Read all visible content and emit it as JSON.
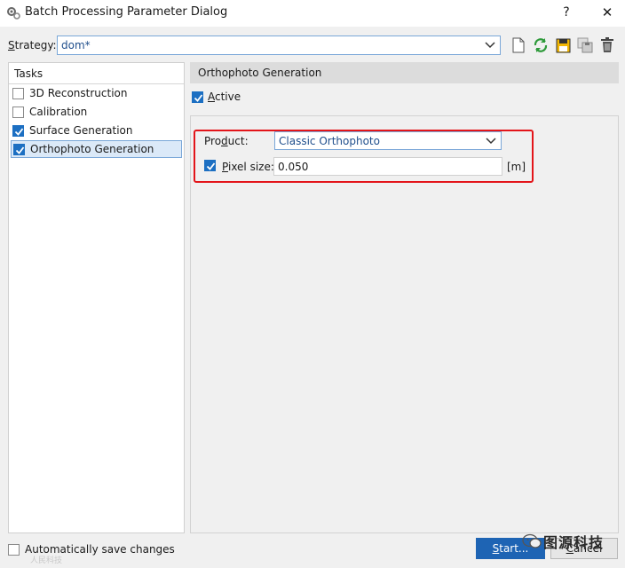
{
  "window": {
    "title": "Batch Processing Parameter Dialog",
    "help_label": "?",
    "close_label": "✕"
  },
  "strategy": {
    "label": "Strategy:",
    "value": "dom*"
  },
  "toolbar": {
    "icons": [
      "new-document-icon",
      "refresh-icon",
      "save-icon",
      "save-as-icon",
      "delete-icon"
    ]
  },
  "tasks": {
    "header": "Tasks",
    "items": [
      {
        "label": "3D Reconstruction",
        "checked": false,
        "selected": false
      },
      {
        "label": "Calibration",
        "checked": false,
        "selected": false
      },
      {
        "label": "Surface Generation",
        "checked": true,
        "selected": false
      },
      {
        "label": "Orthophoto Generation",
        "checked": true,
        "selected": true
      }
    ]
  },
  "section": {
    "title": "Orthophoto Generation",
    "active_label": "Active",
    "active_checked": true
  },
  "parameters": {
    "product_label": "Product:",
    "product_value": "Classic Orthophoto",
    "pixel_size_label": "Pixel size:",
    "pixel_size_checked": true,
    "pixel_size_value": "0.050",
    "pixel_size_unit": "[m]"
  },
  "footer": {
    "auto_save_label": "Automatically save changes",
    "auto_save_checked": false,
    "start_label": "Start...",
    "cancel_label": "Cancel"
  },
  "watermark": {
    "brand_text": "图源科技",
    "small_text": "人民科技"
  },
  "colors": {
    "accent": "#1c6fc2",
    "highlight_border": "#e3151a",
    "primary_button": "#1e64b4"
  }
}
